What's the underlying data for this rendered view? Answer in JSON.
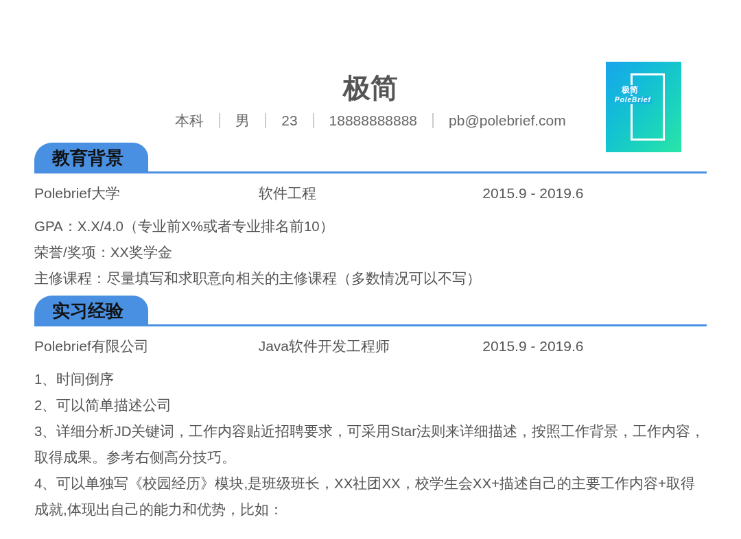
{
  "header": {
    "name": "极简",
    "info": [
      "本科",
      "男",
      "23",
      "18888888888",
      "pb@polebrief.com"
    ],
    "logo": {
      "title": "极简",
      "subtitle": "PoleBrief"
    }
  },
  "sections": [
    {
      "title": "教育背景",
      "entry": [
        "Polebrief大学",
        "软件工程",
        "2015.9 - 2019.6"
      ],
      "lines": [
        "GPA：X.X/4.0（专业前X%或者专业排名前10）",
        "荣誉/奖项：XX奖学金",
        "主修课程：尽量填写和求职意向相关的主修课程（多数情况可以不写）"
      ]
    },
    {
      "title": "实习经验",
      "entry": [
        "Polebrief有限公司",
        "Java软件开发工程师",
        "2015.9 - 2019.6"
      ],
      "lines": [
        "1、时间倒序",
        "2、可以简单描述公司",
        "3、详细分析JD关键词，工作内容贴近招聘要求，可采用Star法则来详细描述，按照工作背景，工作内容，取得成果。参考右侧高分技巧。",
        "4、可以单独写《校园经历》模块,是班级班长，XX社团XX，校学生会XX+描述自己的主要工作内容+取得成就,体现出自己的能力和优势，比如："
      ]
    }
  ]
}
